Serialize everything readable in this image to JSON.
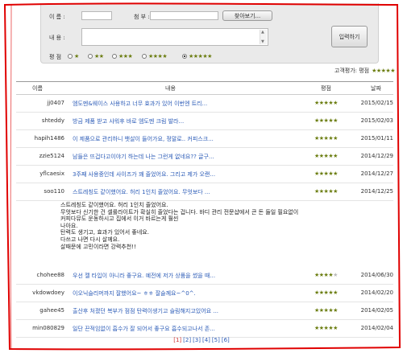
{
  "form": {
    "name_label": "이 름 :",
    "attach_label": "첨 부 :",
    "browse_label": "찾아보기...",
    "content_label": "내 용 :",
    "rating_label": "평 점",
    "submit_label": "입력하기",
    "rating_options": [
      "★",
      "★★",
      "★★★",
      "★★★★",
      "★★★★★"
    ],
    "selected_rating": 5
  },
  "summary": {
    "label": "고객평가: 평점",
    "stars": "★★★★★"
  },
  "table": {
    "headers": {
      "name": "이름",
      "content": "내용",
      "rating": "평점",
      "date": "날짜"
    },
    "rows": [
      {
        "name": "jj0407",
        "content": "엠도멘&웨이스 사용하고 너무 효과가 있어 이번엔 트리...",
        "stars": 5,
        "date": "2015/02/15"
      },
      {
        "name": "shteddy",
        "content": "방금 제품 받고 샤워후 바로 엠도멘 크림 발라...",
        "stars": 5,
        "date": "2015/02/03"
      },
      {
        "name": "hapih1486",
        "content": "이 제품으로 관리하니 뱃살이 들어가요, 정말로.. 커피스크...",
        "stars": 5,
        "date": "2015/01/11"
      },
      {
        "name": "zzie5124",
        "content": "남들은 뜨겁다고이야기 하는데 나는 그런게 없네요?? 글구...",
        "stars": 5,
        "date": "2014/12/29"
      },
      {
        "name": "yflcaesix",
        "content": "3주째 사용중인데 사이즈가 꽤 줄었어요. 그리고 제가 오랜...",
        "stars": 5,
        "date": "2014/12/27"
      },
      {
        "name": "soo110",
        "content": "스트레칭도 같이했어요. 허리 1인치 줄었어요. 무엇보다 ...",
        "stars": 5,
        "date": "2014/12/25"
      },
      {
        "name": "chohee88",
        "content": "우선 젤 타입이 아니라 좋구요. 예전에 저가 상품을 썼을 때...",
        "stars": 4,
        "date": "2014/06/30"
      },
      {
        "name": "vkdowdoey",
        "content": "이오닉슬리머까지 잘했어요~ ㅎㅎ 잘슬께요~^0^.",
        "stars": 5,
        "date": "2014/02/20"
      },
      {
        "name": "gahee45",
        "content": "출산후 처졌던 복부가 점점 탄력이생기고 슬림해지고있어요 ...",
        "stars": 5,
        "date": "2014/02/05"
      },
      {
        "name": "min080829",
        "content": "일단 끈적임없이 흡수가 잘 되어서 좋구요 흡수되고나서 존...",
        "stars": 5,
        "date": "2014/02/04"
      }
    ]
  },
  "expanded_review": [
    "스트레칭도 같이했어요. 허리 1인치 줄었어요.",
    "무엇보다 신기한 건 셀룰라이트가 확실히 줄었다는 겁니다. 바디 관리 전문샵에서 큰 돈 들일 필요없이",
    "커피다뮤도 운동하시고 집에서 이거 바르는게 훨씬",
    "나아요.",
    "탄력도 생기고, 효과가 있어서 좋네요.",
    "다쓰고 나면 다시 살께요.",
    "살때문에 고민이라면 강력추천!!"
  ],
  "pager": [
    "[1]",
    "[2]",
    "[3]",
    "[4]",
    "[5]",
    "[6]"
  ],
  "colors": {
    "star": "#6b7d10",
    "link": "#2b5bb7",
    "frame": "#e00000"
  }
}
